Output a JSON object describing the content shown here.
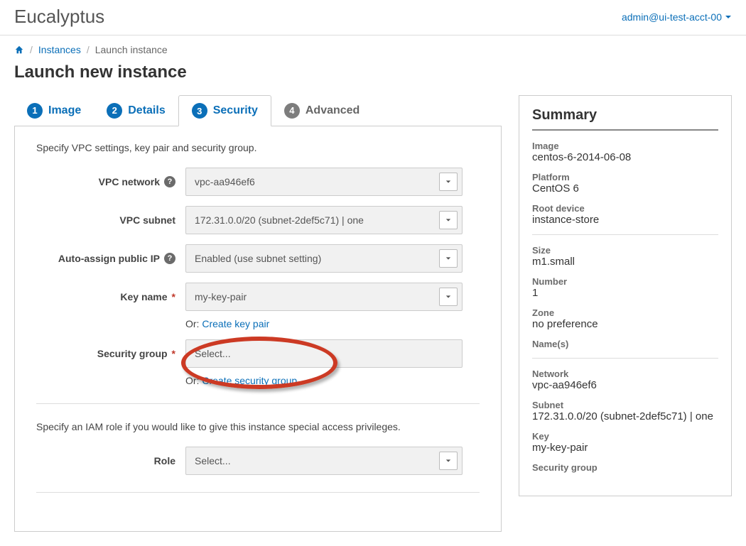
{
  "brand": "Eucalyptus",
  "account": "admin@ui-test-acct-00",
  "breadcrumb": {
    "home_title": "Home",
    "instances": "Instances",
    "current": "Launch instance"
  },
  "page_title": "Launch new instance",
  "tabs": {
    "image": {
      "num": "1",
      "label": "Image"
    },
    "details": {
      "num": "2",
      "label": "Details"
    },
    "security": {
      "num": "3",
      "label": "Security"
    },
    "advanced": {
      "num": "4",
      "label": "Advanced"
    }
  },
  "form": {
    "intro": "Specify VPC settings, key pair and security group.",
    "labels": {
      "vpc_network": "VPC network",
      "vpc_subnet": "VPC subnet",
      "auto_ip": "Auto-assign public IP",
      "key_name": "Key name",
      "security_group": "Security group",
      "role": "Role"
    },
    "values": {
      "vpc_network": "vpc-aa946ef6",
      "vpc_subnet": "172.31.0.0/20 (subnet-2def5c71) | one",
      "auto_ip": "Enabled (use subnet setting)",
      "key_name": "my-key-pair",
      "security_group": "Select...",
      "role": "Select..."
    },
    "or_prefix": "Or: ",
    "links": {
      "create_keypair": "Create key pair",
      "create_sg": "Create security group"
    },
    "iam_intro": "Specify an IAM role if you would like to give this instance special access privileges."
  },
  "summary": {
    "title": "Summary",
    "items": {
      "image": {
        "k": "Image",
        "v": "centos-6-2014-06-08"
      },
      "platform": {
        "k": "Platform",
        "v": "CentOS 6"
      },
      "root": {
        "k": "Root device",
        "v": "instance-store"
      },
      "size": {
        "k": "Size",
        "v": "m1.small"
      },
      "number": {
        "k": "Number",
        "v": "1"
      },
      "zone": {
        "k": "Zone",
        "v": "no preference"
      },
      "names": {
        "k": "Name(s)",
        "v": ""
      },
      "network": {
        "k": "Network",
        "v": "vpc-aa946ef6"
      },
      "subnet": {
        "k": "Subnet",
        "v": "172.31.0.0/20 (subnet-2def5c71) | one"
      },
      "key": {
        "k": "Key",
        "v": "my-key-pair"
      },
      "sg": {
        "k": "Security group",
        "v": ""
      }
    }
  },
  "colors": {
    "accent": "#0b6fb8",
    "required": "#c0392b",
    "callout": "#cc3a24"
  }
}
